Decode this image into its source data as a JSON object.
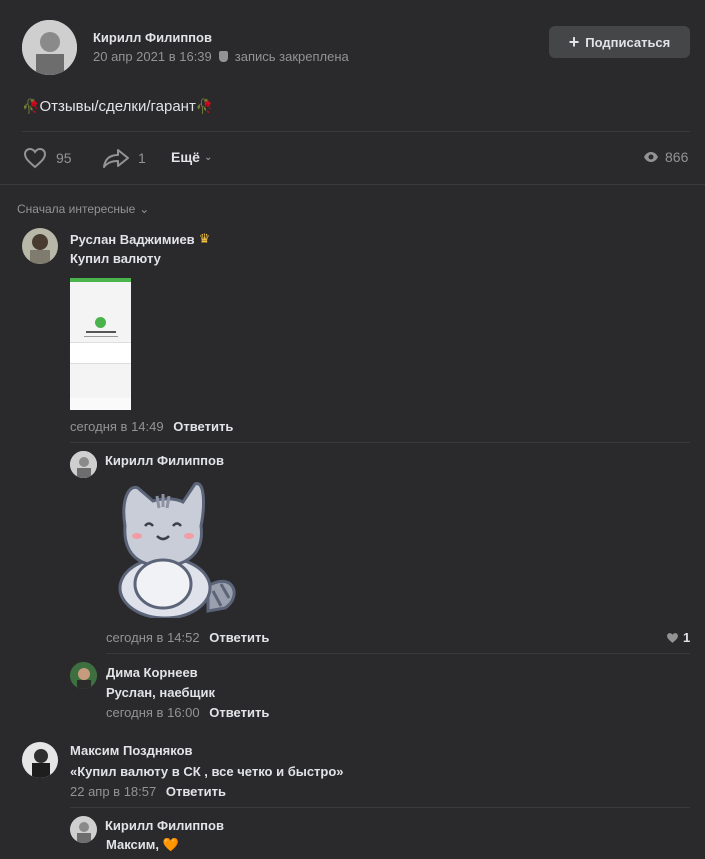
{
  "post": {
    "author": "Кирилл Филиппов",
    "date": "20 апр 2021 в 16:39",
    "pinned": "запись закреплена",
    "subscribe_label": "Подписаться",
    "title_text": "Отзывы/сделки/гарант",
    "title_emoji": "🥀",
    "likes": "95",
    "shares": "1",
    "more_label": "Ещё",
    "views": "866"
  },
  "sort_label": "Сначала интересные",
  "comments": [
    {
      "author": "Руслан Ваджимиев",
      "text": "Купил валюту",
      "time": "сегодня в 14:49",
      "reply": "Ответить"
    },
    {
      "author": "Кирилл Филиппов",
      "time": "сегодня в 14:52",
      "reply": "Ответить",
      "likes": "1"
    },
    {
      "author": "Дима Корнеев",
      "text": "Руслан, наебщик",
      "time": "сегодня в 16:00",
      "reply": "Ответить"
    },
    {
      "author": "Максим Поздняков",
      "text": "«Купил валюту в СК , все четко и быстро»",
      "time": "22 апр в 18:57",
      "reply": "Ответить"
    },
    {
      "author": "Кирилл Филиппов",
      "text": "Максим, ",
      "emoji": "🧡"
    }
  ],
  "colors": {
    "background": "#2a2a2c",
    "accent_green": "#4bb34b",
    "separator": "#3a3a3c"
  }
}
